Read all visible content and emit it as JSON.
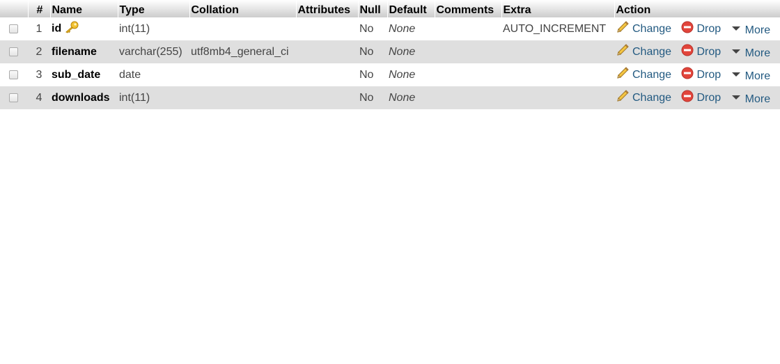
{
  "headers": {
    "num": "#",
    "name": "Name",
    "type": "Type",
    "collation": "Collation",
    "attributes": "Attributes",
    "null": "Null",
    "default": "Default",
    "comments": "Comments",
    "extra": "Extra",
    "action": "Action"
  },
  "actions": {
    "change": "Change",
    "drop": "Drop",
    "more": "More"
  },
  "rows": [
    {
      "num": "1",
      "name": "id",
      "primary_key": true,
      "type": "int(11)",
      "collation": "",
      "attributes": "",
      "null": "No",
      "default": "None",
      "comments": "",
      "extra": "AUTO_INCREMENT"
    },
    {
      "num": "2",
      "name": "filename",
      "primary_key": false,
      "type": "varchar(255)",
      "collation": "utf8mb4_general_ci",
      "attributes": "",
      "null": "No",
      "default": "None",
      "comments": "",
      "extra": ""
    },
    {
      "num": "3",
      "name": "sub_date",
      "primary_key": false,
      "type": "date",
      "collation": "",
      "attributes": "",
      "null": "No",
      "default": "None",
      "comments": "",
      "extra": ""
    },
    {
      "num": "4",
      "name": "downloads",
      "primary_key": false,
      "type": "int(11)",
      "collation": "",
      "attributes": "",
      "null": "No",
      "default": "None",
      "comments": "",
      "extra": ""
    }
  ],
  "colors": {
    "link": "#235a81",
    "row_alt": "#dfdfdf",
    "drop_icon": "#e2453b",
    "key_icon": "#e6b422"
  }
}
